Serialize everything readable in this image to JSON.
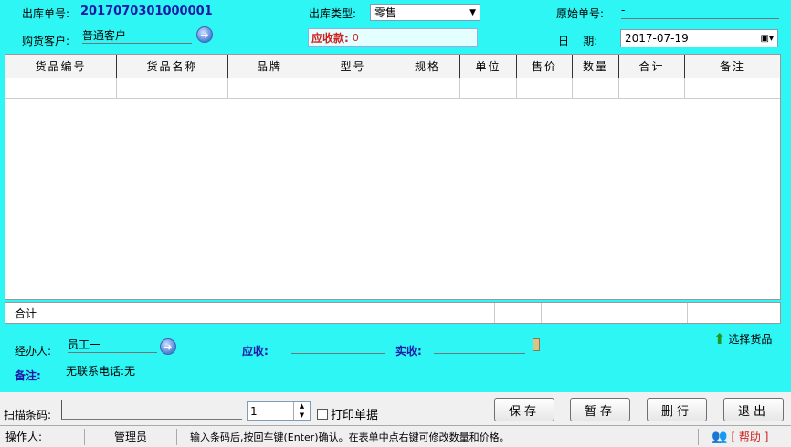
{
  "header": {
    "order_no_label": "出库单号:",
    "order_no_value": "2017070301000001",
    "type_label": "出库类型:",
    "type_value": "零售",
    "orig_no_label": "原始单号:",
    "orig_no_value": "-",
    "customer_label": "购货客户:",
    "customer_value": "普通客户",
    "receivable_label": "应收款:",
    "receivable_value": "0",
    "date_label": "日    期:",
    "date_value": "2017-07-19"
  },
  "grid": {
    "columns": [
      "货品编号",
      "货品名称",
      "品牌",
      "型号",
      "规格",
      "单位",
      "售价",
      "数量",
      "合计",
      "备注"
    ]
  },
  "summary": {
    "total_label": "合计"
  },
  "footer": {
    "handler_label": "经办人:",
    "handler_value": "员工一",
    "receivable_label": "应收:",
    "received_label": "实收:",
    "select_goods_label": "选择货品",
    "note_label": "备注:",
    "note_value": "无联系电话:无"
  },
  "scan": {
    "barcode_label": "扫描条码:",
    "quantity_value": "1",
    "print_label": "打印单据"
  },
  "buttons": {
    "save": "保存",
    "hold": "暂存",
    "delete": "删行",
    "exit": "退出"
  },
  "status": {
    "operator_label": "操作人:",
    "operator_value": "管理员",
    "hint": "输入条码后,按回车键(Enter)确认。在表单中点右键可修改数量和价格。",
    "help": "[ 帮助 ]"
  }
}
